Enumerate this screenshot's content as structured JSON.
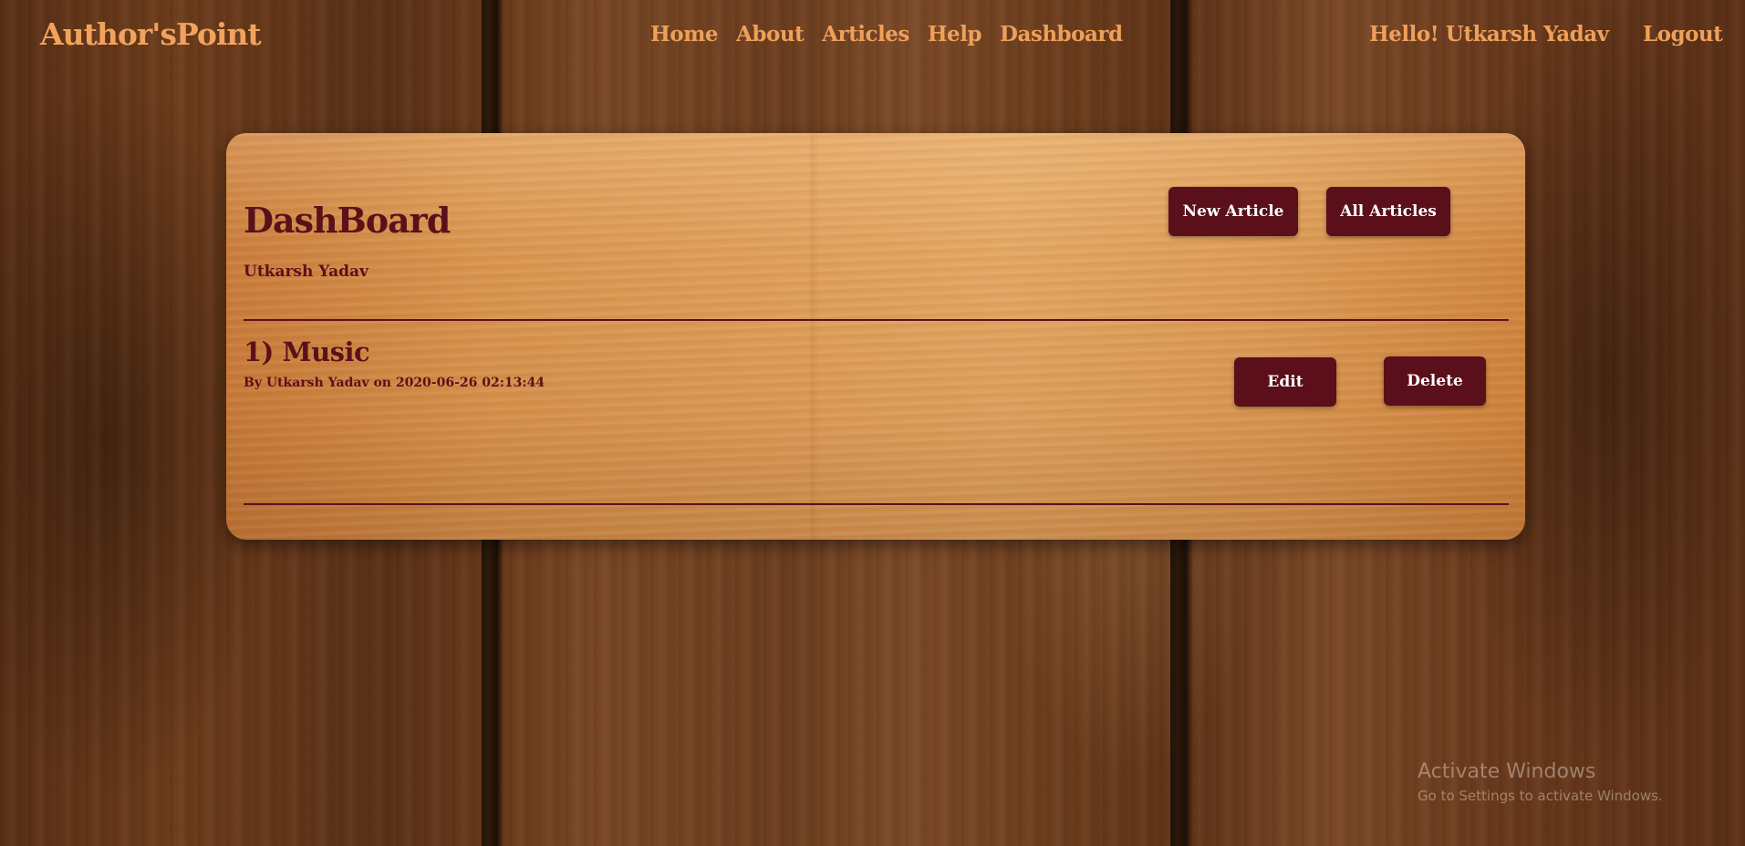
{
  "navbar": {
    "brand": "Author'sPoint",
    "links": [
      {
        "label": "Home"
      },
      {
        "label": "About"
      },
      {
        "label": "Articles"
      },
      {
        "label": "Help"
      },
      {
        "label": "Dashboard"
      }
    ],
    "greeting": "Hello! Utkarsh Yadav",
    "logout": "Logout"
  },
  "dashboard": {
    "title": "DashBoard",
    "username": "Utkarsh Yadav",
    "new_article_label": "New Article",
    "all_articles_label": "All Articles",
    "articles": [
      {
        "title": "1) Music",
        "meta": "By Utkarsh Yadav on 2020-06-26 02:13:44",
        "edit_label": "Edit",
        "delete_label": "Delete"
      }
    ]
  },
  "watermark": {
    "title": "Activate Windows",
    "subtitle": "Go to Settings to activate Windows."
  },
  "colors": {
    "nav_text": "#eea05a",
    "maroon": "#5a0f1b",
    "card_wood": "#dd9b56"
  }
}
